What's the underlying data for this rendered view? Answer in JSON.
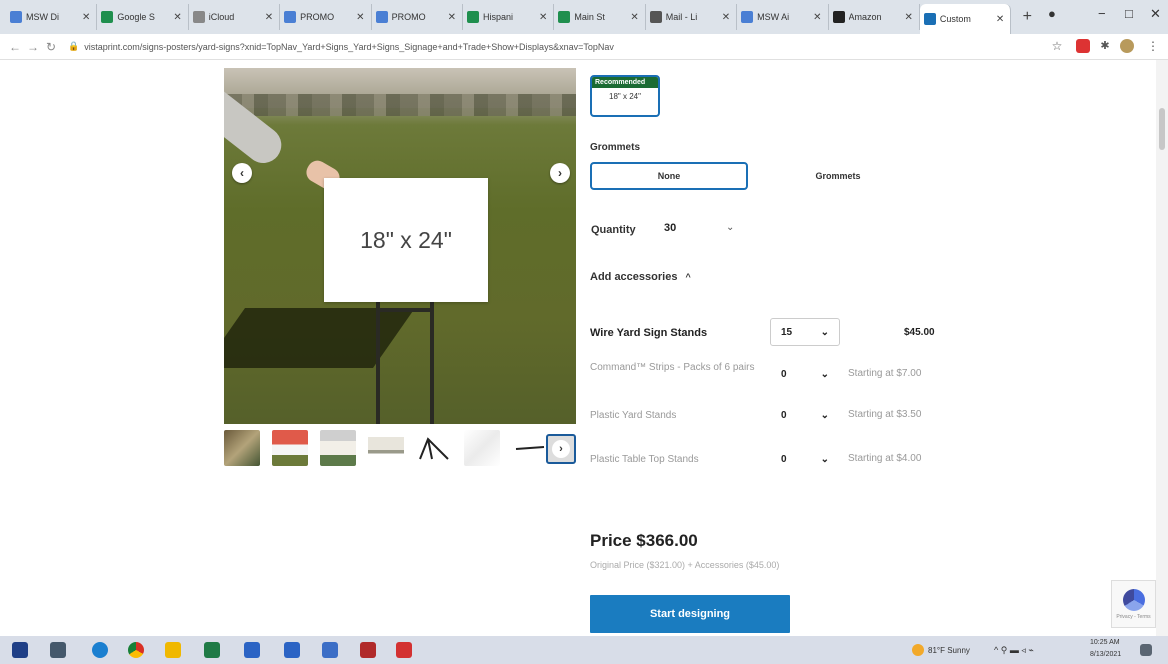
{
  "browser": {
    "tabs": [
      {
        "label": "MSW Di",
        "icon": "docs-icon",
        "color": "#4a7fd4"
      },
      {
        "label": "Google S",
        "icon": "sheets-icon",
        "color": "#1f8f4e"
      },
      {
        "label": "iCloud",
        "icon": "icloud-icon",
        "color": "#888888"
      },
      {
        "label": "PROMO",
        "icon": "docs-icon",
        "color": "#4a7fd4"
      },
      {
        "label": "PROMO",
        "icon": "docs-icon",
        "color": "#4a7fd4"
      },
      {
        "label": "Hispani",
        "icon": "sheets-icon",
        "color": "#1f8f4e"
      },
      {
        "label": "Main St",
        "icon": "sheets-icon",
        "color": "#1f8f4e"
      },
      {
        "label": "Mail - Li",
        "icon": "mail-icon",
        "color": "#555555"
      },
      {
        "label": "MSW Ai",
        "icon": "docs-icon",
        "color": "#4a7fd4"
      },
      {
        "label": "Amazon",
        "icon": "amazon-icon",
        "color": "#222222"
      },
      {
        "label": "Custom",
        "icon": "vistaprint-icon",
        "color": "#1a6fb5",
        "active": true
      }
    ],
    "new_tab": "+",
    "url": "vistaprint.com/signs-posters/yard-signs?xnid=TopNav_Yard+Signs_Yard+Signs_Signage+and+Trade+Show+Displays&xnav=TopNav"
  },
  "gallery": {
    "sign_text": "18\" x 24\"",
    "thumbnails": [
      "thumb-family",
      "thumb-red-sign",
      "thumb-photo-sign",
      "thumb-white-sign",
      "thumb-stand",
      "thumb-plastic",
      "thumb-wire"
    ]
  },
  "options": {
    "recommended_badge": "Recommended",
    "size_label": "18\" x 24\"",
    "grommets_heading": "Grommets",
    "grommet_options": [
      "None",
      "Grommets"
    ],
    "quantity_label": "Quantity",
    "quantity_value": "30",
    "accessories_toggle": "Add accessories",
    "accessories": [
      {
        "name": "Wire Yard Sign Stands",
        "qty": "15",
        "price": "$45.00",
        "selected": true
      },
      {
        "name": "Command™ Strips - Packs of 6 pairs",
        "qty": "0",
        "price": "Starting at $7.00"
      },
      {
        "name": "Plastic Yard Stands",
        "qty": "0",
        "price": "Starting at $3.50"
      },
      {
        "name": "Plastic Table Top Stands",
        "qty": "0",
        "price": "Starting at $4.00"
      }
    ]
  },
  "pricing": {
    "total": "Price $366.00",
    "breakdown": "Original Price ($321.00) + Accessories ($45.00)",
    "cta": "Start designing"
  },
  "recaptcha": {
    "text": "Privacy - Terms"
  },
  "taskbar": {
    "weather": "81°F Sunny",
    "time": "10:25 AM",
    "date": "8/13/2021"
  }
}
